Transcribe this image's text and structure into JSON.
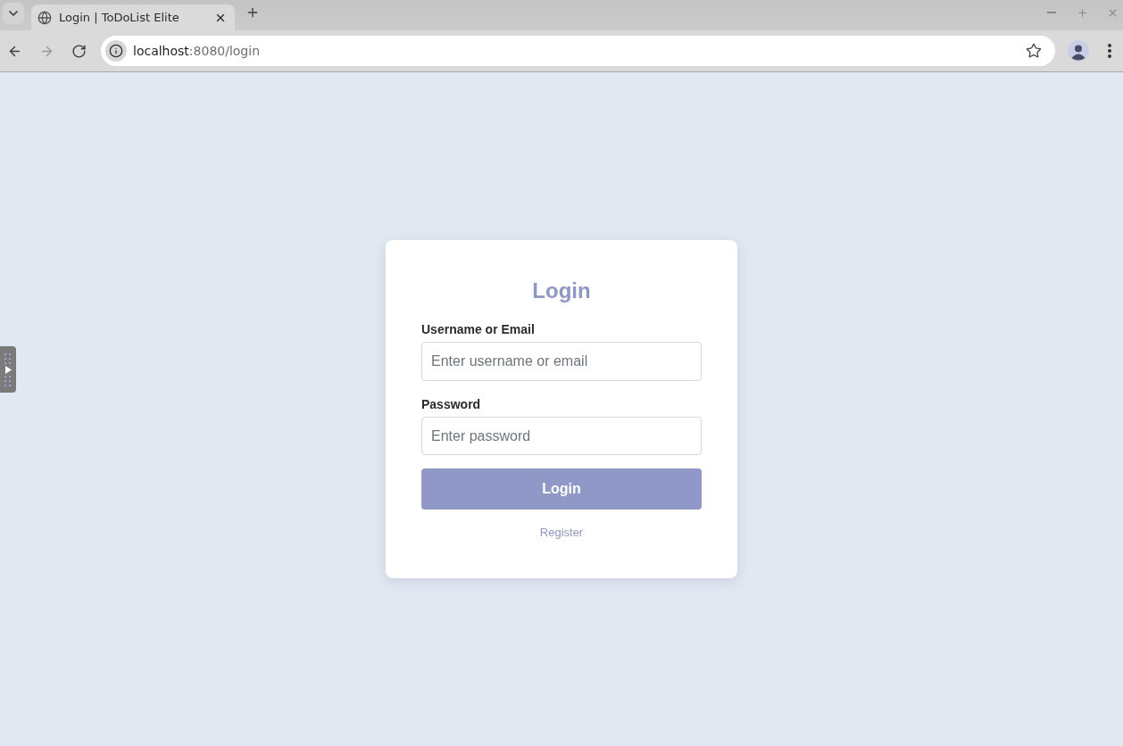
{
  "browser": {
    "tabs": [
      {
        "title": "Login | ToDoList Elite",
        "selected": true
      }
    ],
    "nav_buttons": [
      {
        "kind": "back",
        "disabled": false
      },
      {
        "kind": "forward",
        "disabled": true
      },
      {
        "kind": "reload",
        "disabled": false
      }
    ],
    "address": {
      "host": "localhost",
      "path": ":8080/login"
    }
  },
  "login_form": {
    "title": "Login",
    "username": {
      "label": "Username or Email",
      "placeholder": "Enter username or email"
    },
    "password": {
      "label": "Password",
      "placeholder": "Enter password"
    },
    "submit": "Login",
    "link": "Register"
  }
}
